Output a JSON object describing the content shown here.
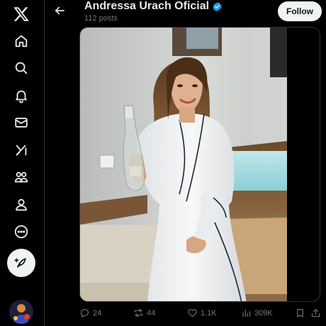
{
  "header": {
    "title": "Andressa Urach Oficial",
    "post_count": "112 posts",
    "follow_label": "Follow"
  },
  "colors": {
    "background": "#000000",
    "text": "#e7e9ea",
    "muted": "#71767b",
    "verified": "#1d9bf0",
    "follow_bg": "#eff3f4"
  },
  "nav": {
    "icons": [
      "x-logo-icon",
      "home-icon",
      "search-icon",
      "notifications-icon",
      "messages-icon",
      "grok-icon",
      "communities-icon",
      "profile-icon",
      "more-icon",
      "post-icon",
      "avatar"
    ]
  },
  "post": {
    "replies": "24",
    "reposts": "44",
    "likes": "1.1K",
    "views": "309K"
  }
}
